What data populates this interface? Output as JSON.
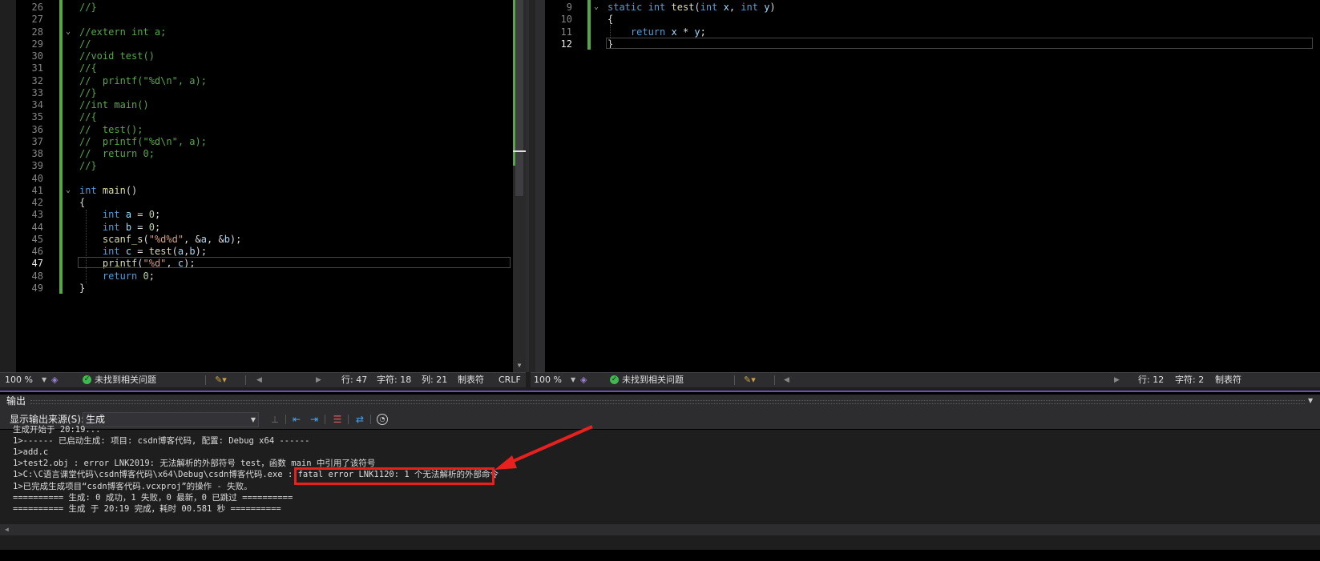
{
  "left_editor": {
    "lines": [
      {
        "n": "26",
        "t": "//}",
        "type": "cm"
      },
      {
        "n": "27",
        "t": "",
        "type": "cm"
      },
      {
        "n": "28",
        "t": "//extern int a;",
        "type": "cm",
        "fold": true
      },
      {
        "n": "29",
        "t": "//",
        "type": "cm"
      },
      {
        "n": "30",
        "t": "//void test()",
        "type": "cm"
      },
      {
        "n": "31",
        "t": "//{",
        "type": "cm"
      },
      {
        "n": "32",
        "t": "//  printf(\"%d\\n\", a);",
        "type": "cm"
      },
      {
        "n": "33",
        "t": "//}",
        "type": "cm"
      },
      {
        "n": "34",
        "t": "//int main()",
        "type": "cm"
      },
      {
        "n": "35",
        "t": "//{",
        "type": "cm"
      },
      {
        "n": "36",
        "t": "//  test();",
        "type": "cm"
      },
      {
        "n": "37",
        "t": "//  printf(\"%d\\n\", a);",
        "type": "cm"
      },
      {
        "n": "38",
        "t": "//  return 0;",
        "type": "cm"
      },
      {
        "n": "39",
        "t": "//}",
        "type": "cm"
      },
      {
        "n": "40",
        "t": "",
        "type": "cm"
      },
      {
        "n": "41",
        "t": "int main()",
        "type": "code",
        "fold": true
      },
      {
        "n": "42",
        "t": "{",
        "type": "code"
      },
      {
        "n": "43",
        "t": "    int a = 0;",
        "type": "code"
      },
      {
        "n": "44",
        "t": "    int b = 0;",
        "type": "code"
      },
      {
        "n": "45",
        "t": "    scanf_s(\"%d%d\", &a, &b);",
        "type": "code"
      },
      {
        "n": "46",
        "t": "    int c = test(a,b);",
        "type": "code"
      },
      {
        "n": "47",
        "t": "    printf(\"%d\", c);",
        "type": "code",
        "current": true
      },
      {
        "n": "48",
        "t": "    return 0;",
        "type": "code"
      },
      {
        "n": "49",
        "t": "}",
        "type": "code"
      }
    ],
    "status": {
      "zoom": "100 %",
      "issues": "未找到相关问题",
      "line": "行: 47",
      "char": "字符: 18",
      "col": "列: 21",
      "tabs": "制表符",
      "eol": "CRLF"
    }
  },
  "right_editor": {
    "lines": [
      {
        "n": "9",
        "t": "static int test(int x, int y)",
        "fold": true
      },
      {
        "n": "10",
        "t": "{"
      },
      {
        "n": "11",
        "t": "    return x * y;"
      },
      {
        "n": "12",
        "t": "}",
        "current": true
      }
    ],
    "status": {
      "zoom": "100 %",
      "issues": "未找到相关问题",
      "line": "行: 12",
      "char": "字符: 2",
      "tabs": "制表符"
    }
  },
  "output": {
    "title": "输出",
    "source_label": "显示输出来源(S):",
    "source_value": "生成",
    "lines": [
      "生成开始于 20:19...",
      "1>------ 已启动生成: 项目: csdn博客代码, 配置: Debug x64 ------",
      "1>add.c",
      "1>test2.obj : error LNK2019: 无法解析的外部符号 test，函数 main 中引用了该符号",
      "1>C:\\C语言课堂代码\\csdn博客代码\\x64\\Debug\\csdn博客代码.exe : fatal error LNK1120: 1 个无法解析的外部命令",
      "1>已完成生成项目“csdn博客代码.vcxproj”的操作 - 失败。",
      "========== 生成: 0 成功，1 失败，0 最新，0 已跳过 ==========",
      "========== 生成 于 20:19 完成，耗时 00.581 秒 =========="
    ],
    "highlight_color": "#e8201e"
  }
}
